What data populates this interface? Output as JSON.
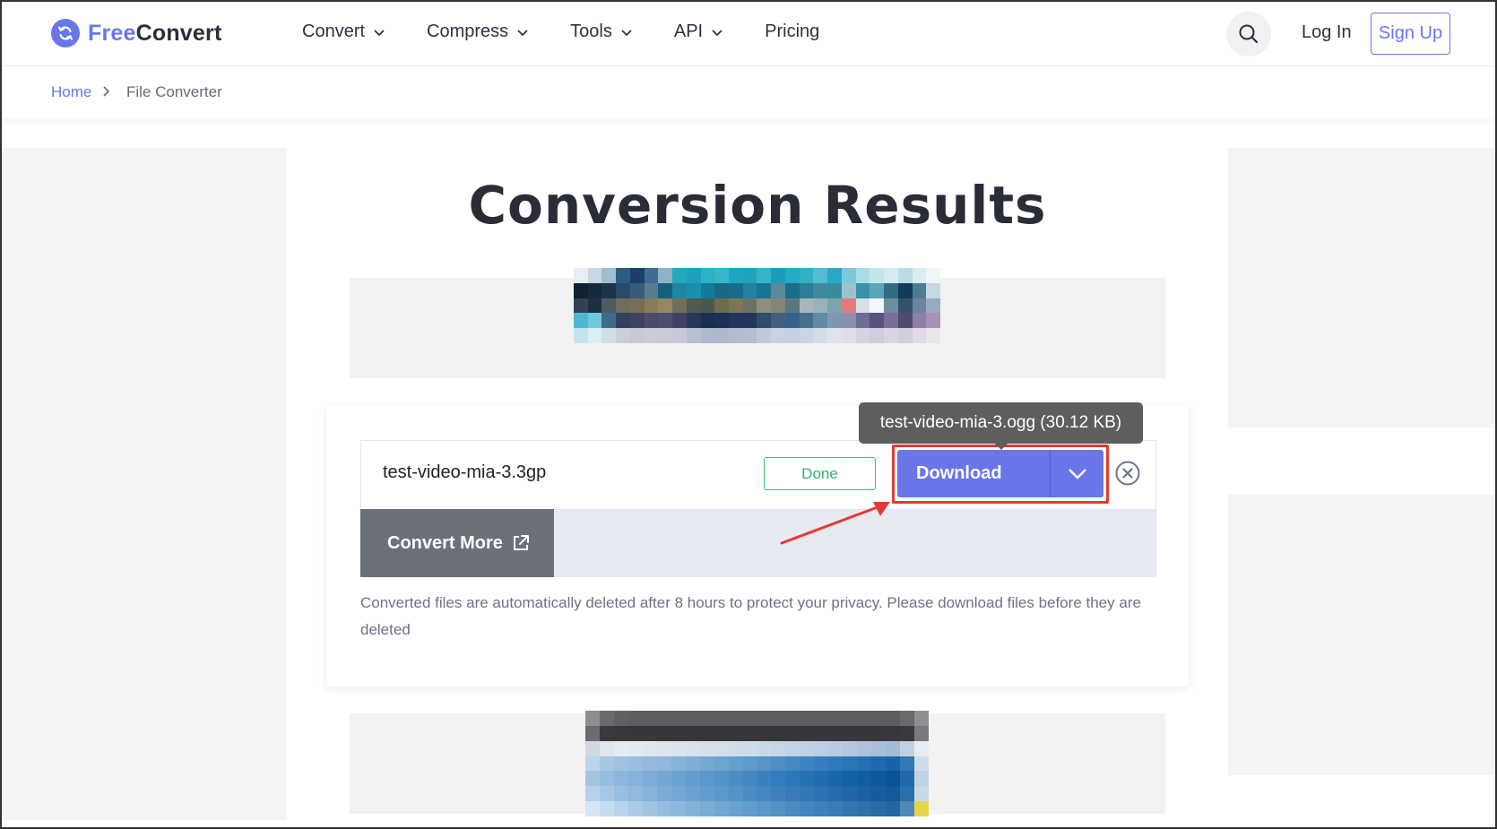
{
  "brand": {
    "name_part1": "Free",
    "name_part2": "Convert",
    "color": "#6a76e8"
  },
  "nav": [
    {
      "label": "Convert",
      "has_dropdown": true
    },
    {
      "label": "Compress",
      "has_dropdown": true
    },
    {
      "label": "Tools",
      "has_dropdown": true
    },
    {
      "label": "API",
      "has_dropdown": true
    },
    {
      "label": "Pricing",
      "has_dropdown": false
    }
  ],
  "header": {
    "login_label": "Log In",
    "signup_label": "Sign Up",
    "search_icon": "search-icon"
  },
  "breadcrumb": {
    "home": "Home",
    "current": "File Converter"
  },
  "page": {
    "title": "Conversion Results"
  },
  "result": {
    "file_name": "test-video-mia-3.3gp",
    "status": "Done",
    "download_label": "Download",
    "tooltip": "test-video-mia-3.ogg (30.12 KB)",
    "convert_more_label": "Convert More",
    "notice": "Converted files are automatically deleted after 8 hours to protect your privacy. Please download files before they are deleted"
  },
  "colors": {
    "accent": "#6a76e8",
    "done_green": "#2fb567",
    "highlight_red": "#e53935",
    "convert_more_bg": "#6c7079"
  }
}
